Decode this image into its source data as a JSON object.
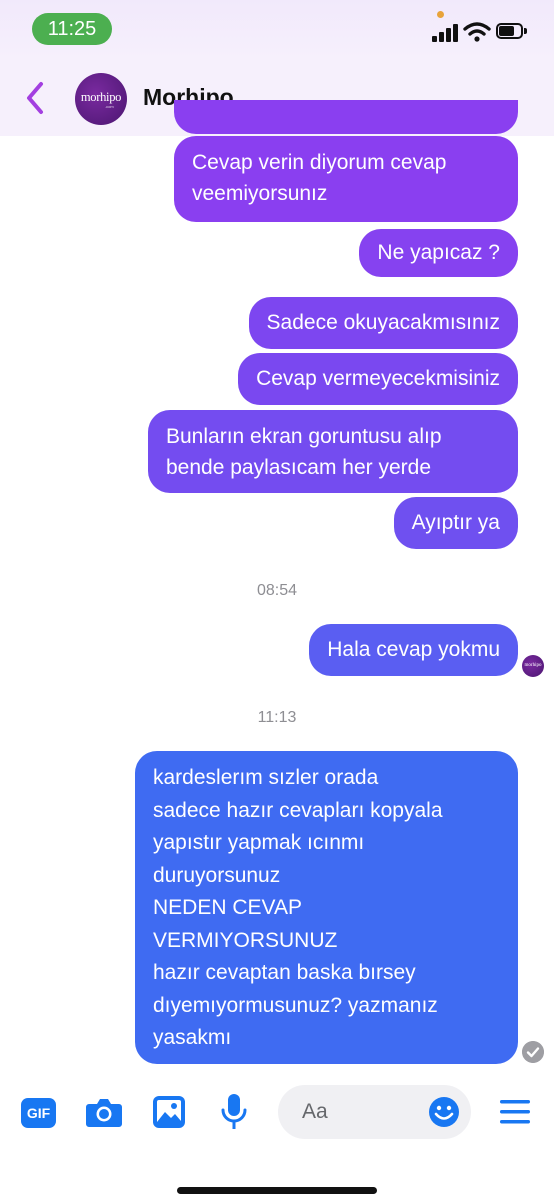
{
  "status": {
    "time": "11:25"
  },
  "header": {
    "title": "Morhipo",
    "avatar_text": "morhipo",
    "avatar_sub": ".com"
  },
  "messages": [
    {
      "text": "Cevap verin diyorum cevap\nveemiyorsunız"
    },
    {
      "text": "Ne yapıcaz ?"
    },
    {
      "text": "Sadece okuyacakmısınız"
    },
    {
      "text": "Cevap vermeyecekmisiniz"
    },
    {
      "text": "Bunların ekran goruntusu alıp\nbende paylasıcam her yerde"
    },
    {
      "text": "Ayıptır ya"
    },
    {
      "text": "Hala cevap yokmu"
    },
    {
      "text": "kardeslerım sızler orada\nsadece hazır cevapları kopyala\nyapıstır yapmak ıcınmı\nduruyorsunuz\nNEDEN CEVAP\nVERMIYORSUNUZ\nhazır cevaptan baska bırsey\ndıyemıyormusunuz? yazmanız\nyasakmı"
    }
  ],
  "timestamps": {
    "t1": "08:54",
    "t2": "11:13"
  },
  "composer": {
    "gif_label": "GIF",
    "placeholder": "Aa"
  },
  "colors": {
    "bubble_top": "#8a3ff0",
    "bubble_bottom": "#3d6cf2",
    "accent": "#1877f2",
    "header_back": "#a33fe0"
  }
}
